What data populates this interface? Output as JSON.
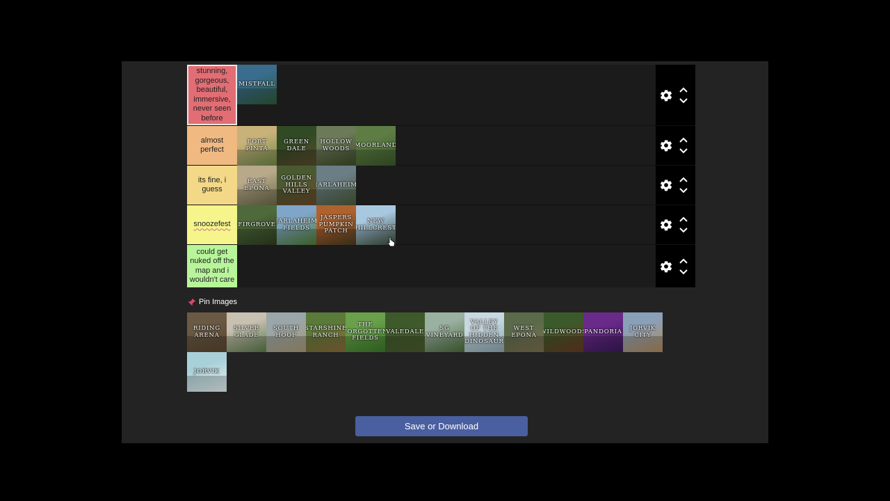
{
  "tiers": [
    {
      "label": "stunning, gorgeous, beautiful, immersive, never seen before",
      "color": "#e26d74",
      "items": [
        {
          "label": "MISTFALL",
          "colors": [
            "#3a6c8e",
            "#2f5a3b"
          ]
        }
      ]
    },
    {
      "label": "almost perfect",
      "color": "#f0b982",
      "items": [
        {
          "label": "FORT PINTA",
          "colors": [
            "#c9b27a",
            "#6f8a4a"
          ]
        },
        {
          "label": "GREEN DALE",
          "colors": [
            "#2f4a24",
            "#5a4a2e"
          ]
        },
        {
          "label": "HOLLOW WOODS",
          "colors": [
            "#6c7a5a",
            "#3c4a2a"
          ]
        },
        {
          "label": "MOORLAND",
          "colors": [
            "#5e7d45",
            "#3a5a2a"
          ]
        }
      ]
    },
    {
      "label": "its fine, i guess",
      "color": "#f3d887",
      "items": [
        {
          "label": "EAST EPONA",
          "colors": [
            "#b8a98a",
            "#6b6a4a"
          ]
        },
        {
          "label": "GOLDEN HILLS VALLEY",
          "colors": [
            "#4a5a30",
            "#6a4a2a"
          ]
        },
        {
          "label": "JARLAHEIM",
          "colors": [
            "#6b7e86",
            "#4a5a3a"
          ]
        }
      ]
    },
    {
      "label": "snoozefest",
      "color": "#f6f58c",
      "items": [
        {
          "label": "FIRGROVE",
          "colors": [
            "#4e6a3a",
            "#2f3e22"
          ]
        },
        {
          "label": "JARLAHEIM FIELDS",
          "colors": [
            "#7fa6c8",
            "#4e7a34"
          ]
        },
        {
          "label": "JASPERS PUMPKIN PATCH",
          "colors": [
            "#b0622e",
            "#4a3a20"
          ]
        },
        {
          "label": "NEW HILLCREST",
          "colors": [
            "#a8c8e0",
            "#3a4a3a"
          ]
        }
      ]
    },
    {
      "label": "could get nuked off the map and i wouldn't care",
      "color": "#b8f59a",
      "items": []
    }
  ],
  "pin": {
    "header": "Pin Images",
    "icon": "pushpin-icon"
  },
  "pool": [
    {
      "label": "RIDING ARENA",
      "colors": [
        "#6a5a44",
        "#5a4630"
      ]
    },
    {
      "label": "SILVER GLADE",
      "colors": [
        "#c8c0b0",
        "#5a7a4a"
      ]
    },
    {
      "label": "SOUTH HOOF",
      "colors": [
        "#9aa6a8",
        "#a89a78"
      ]
    },
    {
      "label": "STARSHINE RANCH",
      "colors": [
        "#5a7a3a",
        "#8a6a3a"
      ]
    },
    {
      "label": "THE FORGOTTEN FIELDS",
      "colors": [
        "#6aa04a",
        "#3a7a2a"
      ]
    },
    {
      "label": "VALEDALE",
      "colors": [
        "#3e5a2a",
        "#4a5a30"
      ]
    },
    {
      "label": "SG VINEYARD",
      "colors": [
        "#9ab0a0",
        "#4a6a3a"
      ]
    },
    {
      "label": "VALLEY OF THE HIDDEN DINOSAUR",
      "colors": [
        "#c8d8e0",
        "#8aa8b0"
      ]
    },
    {
      "label": "WEST EPONA",
      "colors": [
        "#5a6a4a",
        "#7a7050"
      ]
    },
    {
      "label": "WILDWOODS",
      "colors": [
        "#3a5a2a",
        "#6a3a24"
      ]
    },
    {
      "label": "PANDORIA",
      "colors": [
        "#6a2a8a",
        "#3a1a5a"
      ]
    },
    {
      "label": "JORVIK CITY",
      "colors": [
        "#8aa0b8",
        "#b08a5a"
      ]
    },
    {
      "label": "JORVIK",
      "colors": [
        "#a8d0d8",
        "#e8f0f0"
      ]
    }
  ],
  "save_button": {
    "label": "Save or Download",
    "color": "#4a5fa0"
  }
}
